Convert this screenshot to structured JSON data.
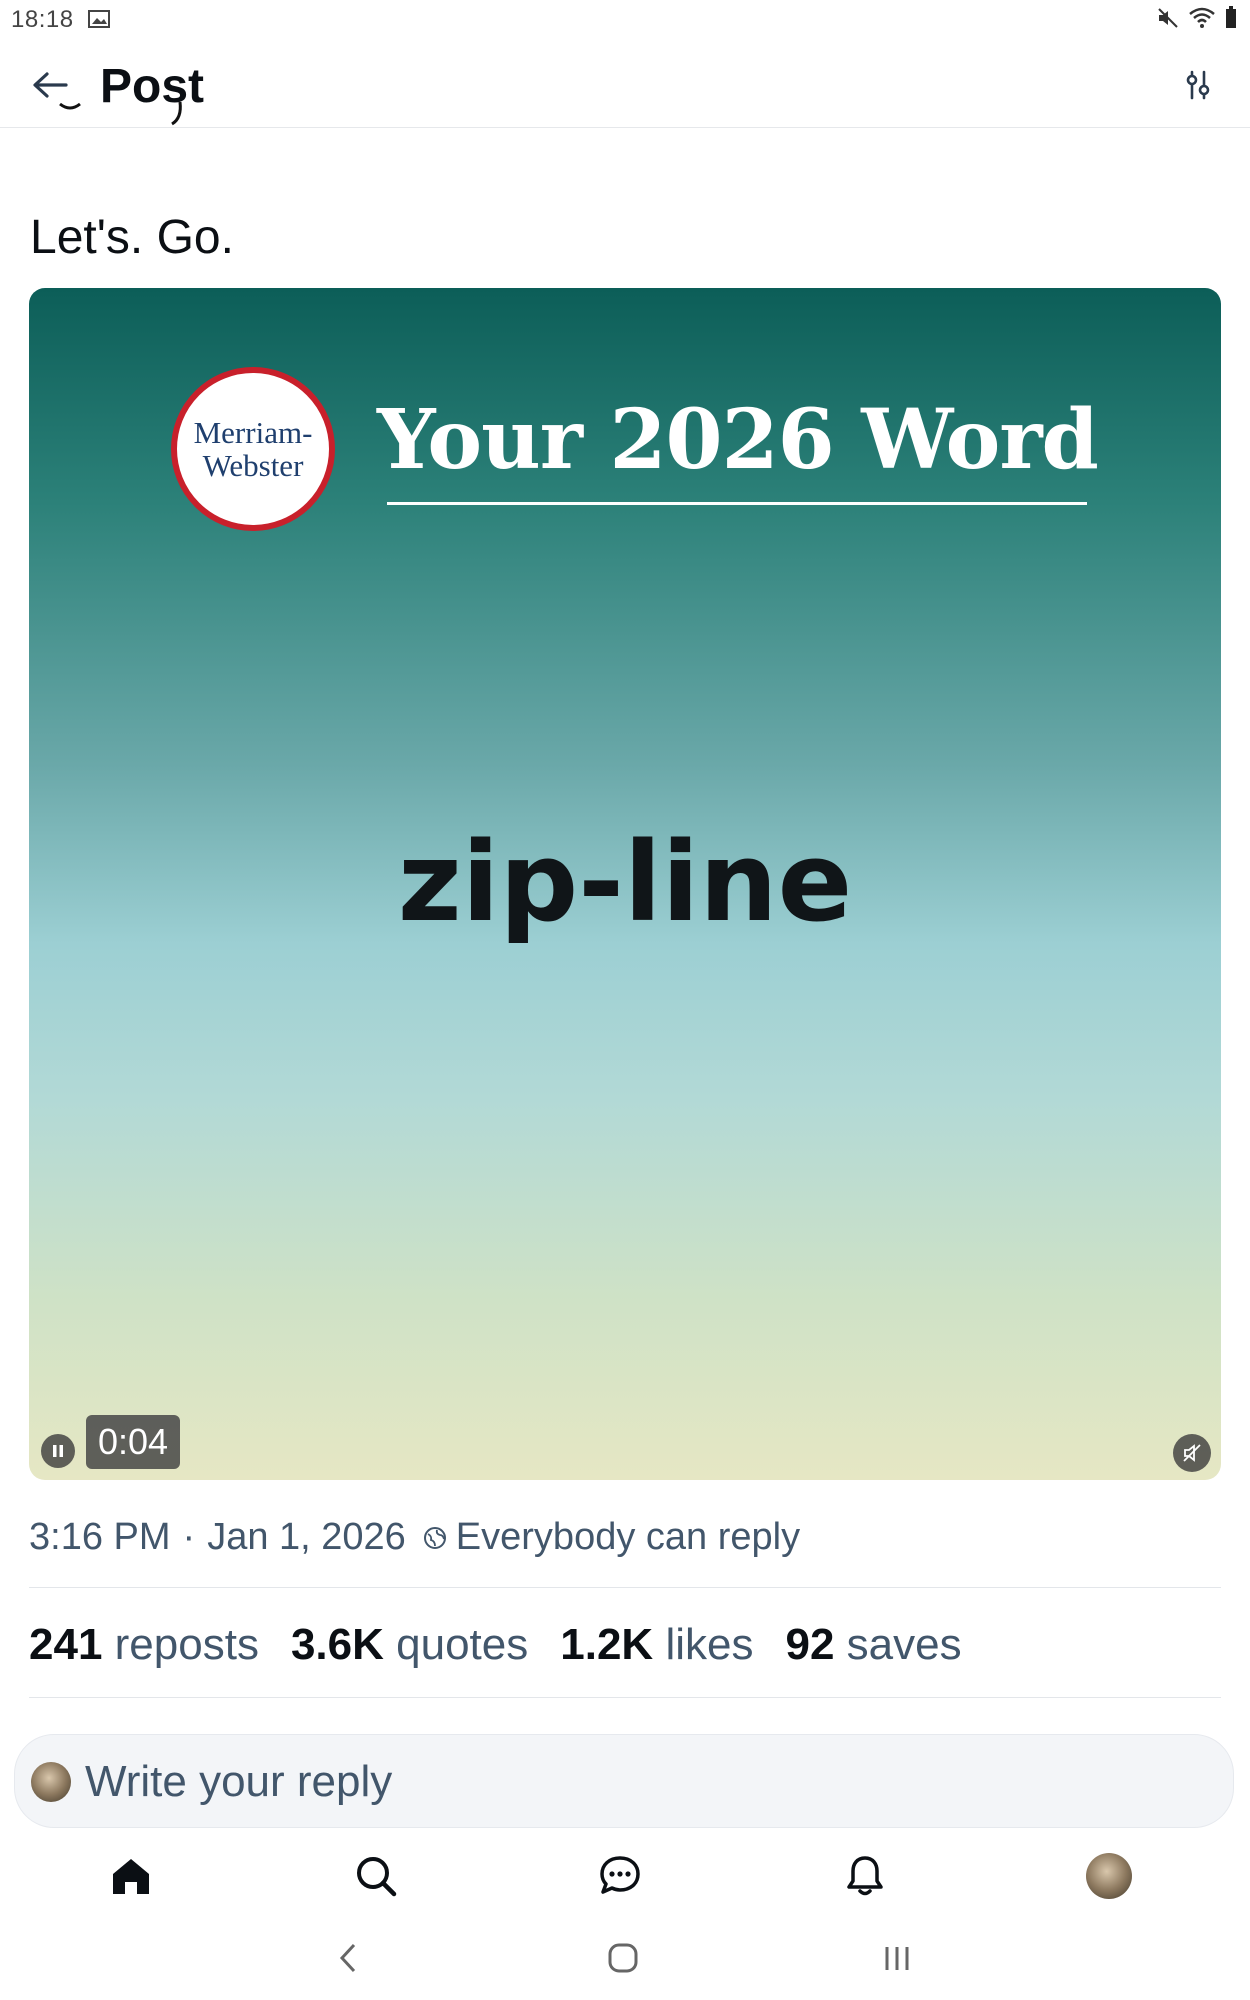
{
  "status_bar": {
    "time": "18:18",
    "icons": [
      "image-icon",
      "mute-icon",
      "wifi-icon",
      "battery-icon"
    ]
  },
  "app_bar": {
    "title": "Post",
    "back_icon": "arrow-left-icon",
    "filter_icon": "sliders-icon"
  },
  "post": {
    "text": "Let's. Go.",
    "media": {
      "brand_line1": "Merriam-",
      "brand_line2": "Webster",
      "headline": "Your 2026 Word",
      "word": "zip-line",
      "duration": "0:04",
      "colors": {
        "top": "#0c5e58",
        "middle": "#9ccfd3",
        "bottom": "#e6e7c4",
        "seal_red": "#c8202b"
      }
    },
    "time": "3:16 PM",
    "date": "Jan 1, 2026",
    "reply_setting": "Everybody can reply"
  },
  "stats": [
    {
      "count": "241",
      "label": "reposts"
    },
    {
      "count": "3.6K",
      "label": "quotes"
    },
    {
      "count": "1.2K",
      "label": "likes"
    },
    {
      "count": "92",
      "label": "saves"
    }
  ],
  "reply": {
    "placeholder": "Write your reply"
  },
  "bottom_nav": [
    "home-icon",
    "search-icon",
    "chat-icon",
    "bell-icon",
    "profile-avatar"
  ],
  "system_nav": [
    "back-chevron-icon",
    "home-circle-icon",
    "recents-icon"
  ]
}
